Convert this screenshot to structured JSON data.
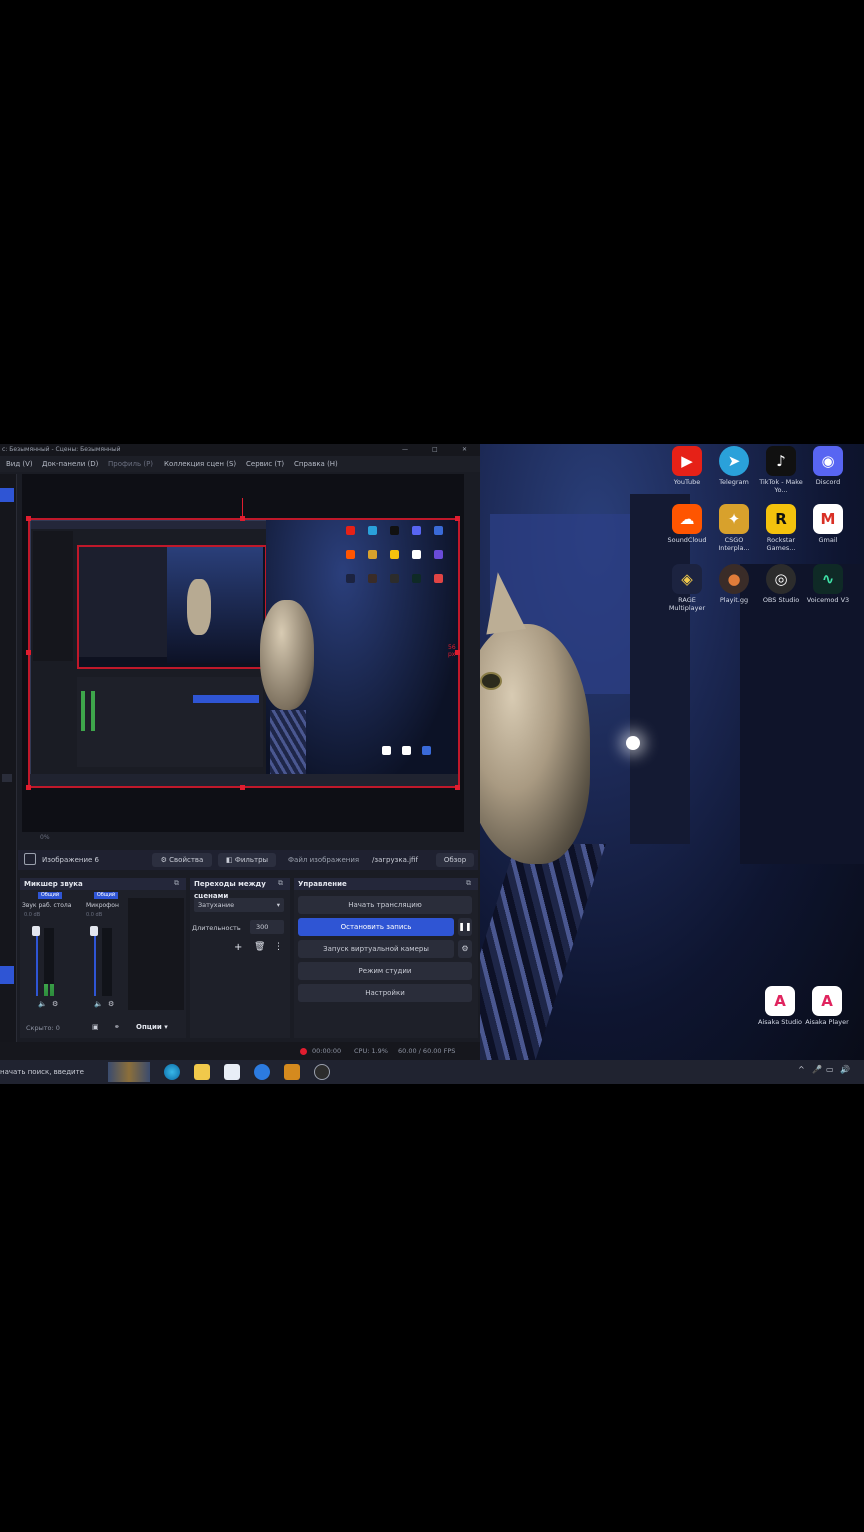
{
  "obs": {
    "title": "с: Безымянный - Сцены: Безымянный",
    "menu": [
      "Вид (V)",
      "Док-панели (D)",
      "Профиль (P)",
      "Коллекция сцен (S)",
      "Сервис (T)",
      "Справка (H)"
    ],
    "preview_size_label": "56 px",
    "scene_label": "0%",
    "source_label": "Изображение 6",
    "properties_button": "Свойства",
    "filters_button": "Фильтры",
    "image_file_label": "Файл изображения",
    "image_file_value": "/загрузка.jfif",
    "browse_button": "Обзор",
    "mixer": {
      "title": "Микшер звука",
      "channel1": {
        "tag": "Общий",
        "name": "Звук раб. стола",
        "db": "0.0 dB"
      },
      "channel2": {
        "tag": "Общий",
        "name": "Микрофон",
        "db": "0.0 dB"
      },
      "hidden": "Скрыто: 0",
      "options": "Опции"
    },
    "transitions": {
      "title": "Переходы между сценами",
      "type": "Затухание",
      "duration_label": "Длительность",
      "duration_value": "300"
    },
    "controls": {
      "title": "Управление",
      "start_stream": "Начать трансляцию",
      "stop_recording": "Остановить запись",
      "virtual_cam": "Запуск виртуальной камеры",
      "studio_mode": "Режим студии",
      "settings": "Настройки"
    },
    "status": {
      "rec_time": "00:00:00",
      "cpu": "CPU: 1.9%",
      "fps": "60.00 / 60.00 FPS"
    }
  },
  "desktop_icons": [
    {
      "label": "YouTube",
      "color": "#e62117",
      "glyph": "▶",
      "icon": "youtube-icon"
    },
    {
      "label": "Telegram",
      "color": "#2aa1da",
      "glyph": "➤",
      "icon": "telegram-icon"
    },
    {
      "label": "TikTok - Make Yo...",
      "color": "#111111",
      "glyph": "♪",
      "icon": "tiktok-icon"
    },
    {
      "label": "Discord",
      "color": "#5865f2",
      "glyph": "◉",
      "icon": "discord-icon"
    },
    {
      "label": "SoundCloud",
      "color": "#ff5500",
      "glyph": "☁",
      "icon": "soundcloud-icon"
    },
    {
      "label": "CSGO Interpla...",
      "color": "#d8a12c",
      "glyph": "✦",
      "icon": "csgo-icon"
    },
    {
      "label": "Rockstar Games...",
      "color": "#f4c20d",
      "glyph": "R",
      "icon": "rockstar-icon"
    },
    {
      "label": "Gmail",
      "color": "#ffffff",
      "glyph": "M",
      "icon": "gmail-icon"
    },
    {
      "label": "RAGE Multiplayer",
      "color": "#1c2340",
      "glyph": "◈",
      "icon": "rage-icon"
    },
    {
      "label": "Playit.gg",
      "color": "#3a2c28",
      "glyph": "●",
      "icon": "playit-icon"
    },
    {
      "label": "OBS Studio",
      "color": "#2c2c2c",
      "glyph": "◎",
      "icon": "obs-icon"
    },
    {
      "label": "Voicemod V3",
      "color": "#0f2a26",
      "glyph": "∿",
      "icon": "voicemod-icon"
    }
  ],
  "desktop_icons_bottom": [
    {
      "label": "Aisaka Studio",
      "color": "#ffffff",
      "glyph": "A",
      "icon": "aisaka-studio-icon"
    },
    {
      "label": "Aisaka Player",
      "color": "#ffffff",
      "glyph": "A",
      "icon": "aisaka-player-icon"
    }
  ],
  "taskbar": {
    "search_placeholder": "начать поиск, введите"
  }
}
